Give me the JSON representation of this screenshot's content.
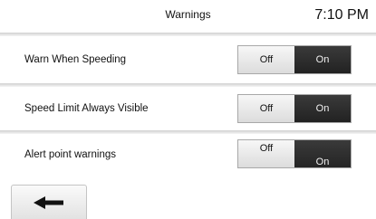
{
  "header": {
    "title": "Warnings",
    "time": "7:10 PM"
  },
  "settings": [
    {
      "label": "Warn When Speeding",
      "off_label": "Off",
      "on_label": "On",
      "state": "On"
    },
    {
      "label": "Speed Limit Always Visible",
      "off_label": "Off",
      "on_label": "On",
      "state": "On"
    },
    {
      "label": "Alert point warnings",
      "off_label": "Off",
      "on_label": "On",
      "state": "On"
    }
  ],
  "footer": {
    "back_icon": "arrow-left-icon"
  },
  "colors": {
    "toggle_on": "#2c2c2c",
    "toggle_off": "#e6e6e6",
    "background": "#ffffff"
  }
}
